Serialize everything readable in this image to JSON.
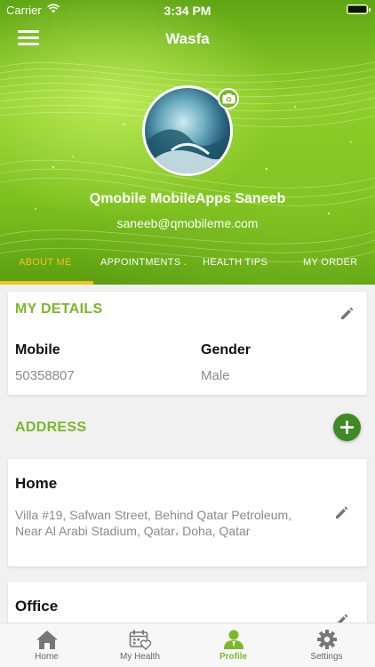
{
  "status_bar": {
    "carrier": "Carrier",
    "time": "3:34 PM"
  },
  "nav": {
    "title": "Wasfa"
  },
  "profile": {
    "name": "Qmobile MobileApps Saneeb",
    "email": "saneeb@qmobileme.com"
  },
  "tabs": [
    {
      "label": "ABOUT ME",
      "active": true
    },
    {
      "label": "APPOINTMENTS ."
    },
    {
      "label": "HEALTH TIPS"
    },
    {
      "label": "MY ORDER"
    }
  ],
  "my_details": {
    "title": "MY DETAILS",
    "mobile_label": "Mobile",
    "mobile_value": "50358807",
    "gender_label": "Gender",
    "gender_value": "Male"
  },
  "address": {
    "title": "ADDRESS",
    "items": [
      {
        "label": "Home",
        "text": "Villa #19, Safwan Street, Behind Qatar Petroleum, Near Al Arabi Stadium, Qatar، Doha, Qatar"
      },
      {
        "label": "Office",
        "text": ""
      }
    ]
  },
  "tabbar": [
    {
      "label": "Home",
      "icon": "home-icon"
    },
    {
      "label": "My Health",
      "icon": "calendar-heart-icon"
    },
    {
      "label": "Profile",
      "icon": "profile-icon",
      "active": true
    },
    {
      "label": "Settings",
      "icon": "gear-icon"
    }
  ],
  "colors": {
    "accent": "#7cb72a",
    "tab_active": "#f4c21a",
    "add_button": "#3f8a25"
  }
}
